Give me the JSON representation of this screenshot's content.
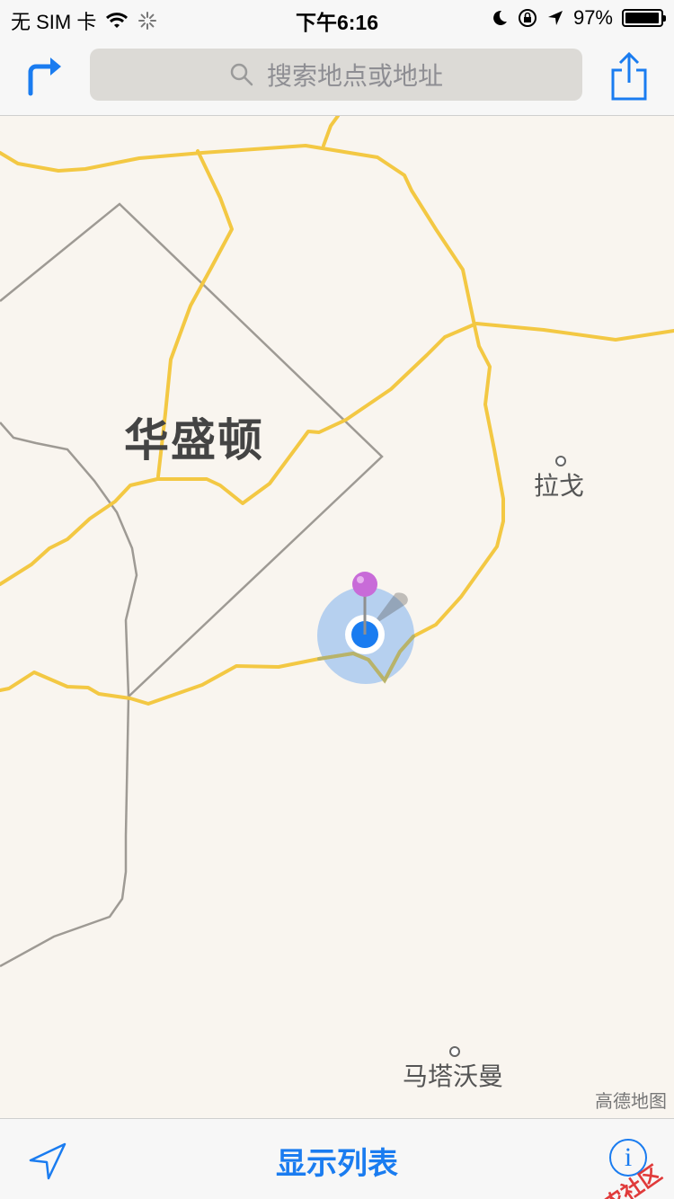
{
  "status_bar": {
    "carrier": "无 SIM 卡",
    "time": "下午6:16",
    "battery_text": "97%",
    "battery_level": 0.97
  },
  "nav": {
    "search_placeholder": "搜索地点或地址"
  },
  "map": {
    "city_label": "华盛顿",
    "towns": [
      {
        "name": "拉戈"
      },
      {
        "name": "马塔沃曼"
      }
    ],
    "attribution": "高德地图"
  },
  "toolbar": {
    "list_label": "显示列表",
    "info_label": "i",
    "watermark": "卡农社区"
  },
  "colors": {
    "accent": "#1a7cf0",
    "road": "#f3c843",
    "border": "#9b9b9b",
    "pin": "#c86bd8",
    "location": "#1a7cf0"
  }
}
